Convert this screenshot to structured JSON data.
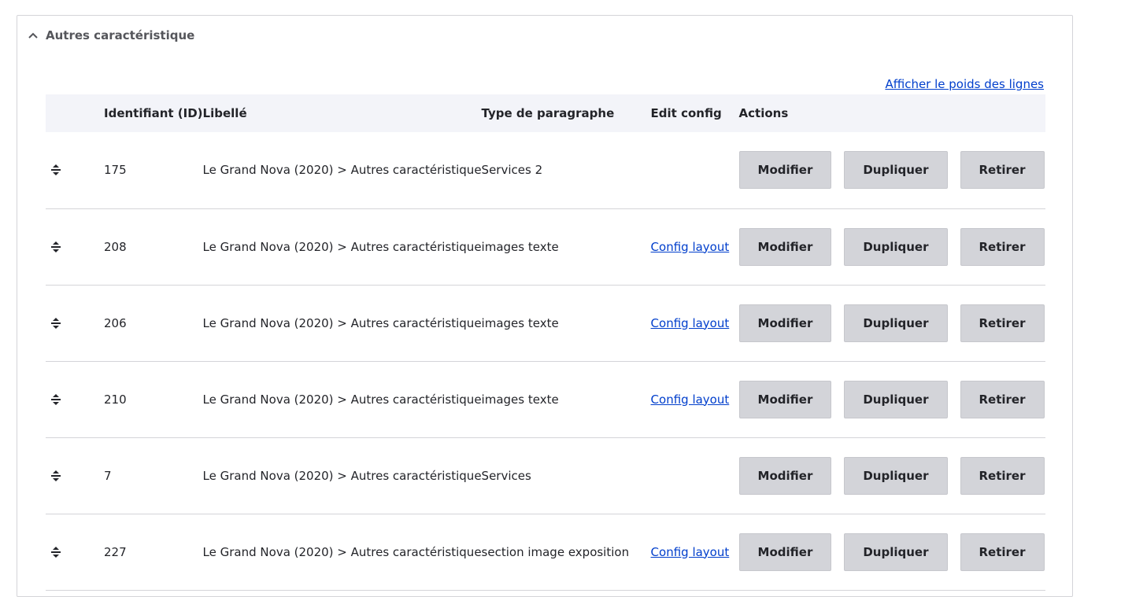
{
  "panel": {
    "title": "Autres caractéristique",
    "weight_link": "Afficher le poids des lignes"
  },
  "table": {
    "headers": {
      "id": "Identifiant (ID)",
      "label": "Libellé",
      "type": "Type de paragraphe",
      "edit": "Edit config",
      "actions": "Actions"
    },
    "rows": [
      {
        "id": "175",
        "label": "Le Grand Nova (2020) > Autres caractéristique",
        "type": "Services 2",
        "edit": ""
      },
      {
        "id": "208",
        "label": "Le Grand Nova (2020) > Autres caractéristique",
        "type": "images texte",
        "edit": "Config layout"
      },
      {
        "id": "206",
        "label": "Le Grand Nova (2020) > Autres caractéristique",
        "type": "images texte",
        "edit": "Config layout"
      },
      {
        "id": "210",
        "label": "Le Grand Nova (2020) > Autres caractéristique",
        "type": "images texte",
        "edit": "Config layout"
      },
      {
        "id": "7",
        "label": "Le Grand Nova (2020) > Autres caractéristique",
        "type": "Services",
        "edit": ""
      },
      {
        "id": "227",
        "label": "Le Grand Nova (2020) > Autres caractéristique",
        "type": "section image exposition",
        "edit": "Config layout"
      }
    ]
  },
  "buttons": {
    "modify": "Modifier",
    "duplicate": "Dupliquer",
    "remove": "Retirer"
  },
  "icons": {
    "collapse": "chevron-up-icon",
    "drag": "drag-handle-icon"
  },
  "colors": {
    "link": "#003ecc",
    "button_bg": "#d3d4d9",
    "header_bg": "#f3f4f9"
  }
}
